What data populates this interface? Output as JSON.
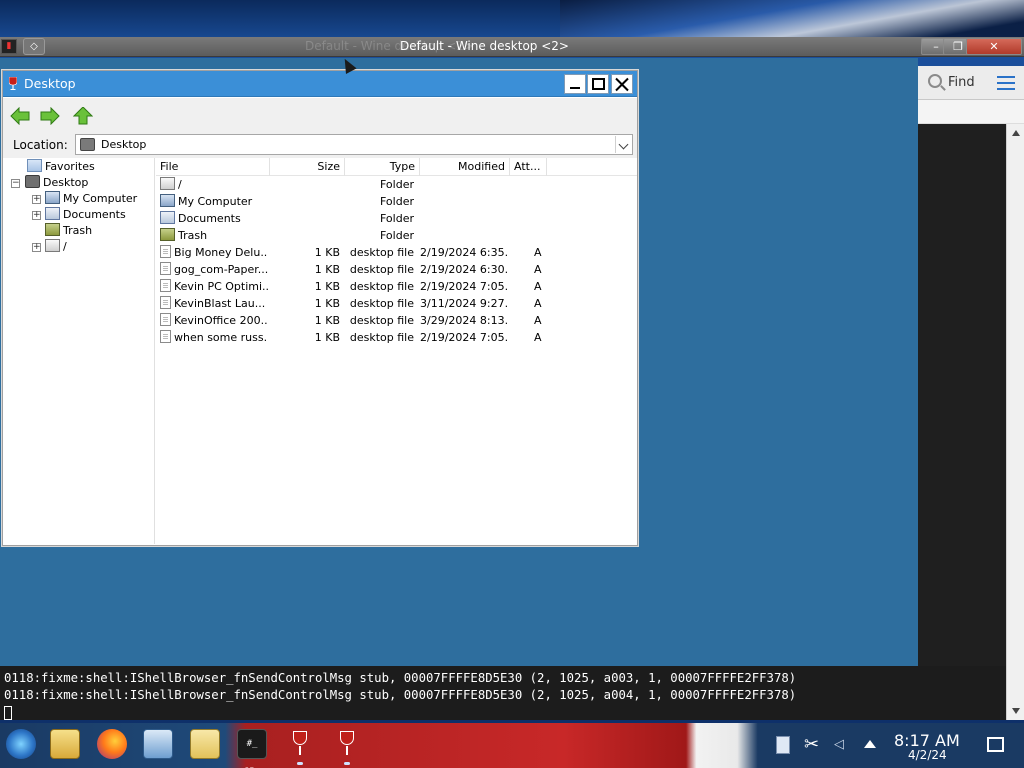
{
  "wine_desktop": {
    "title": "Default - Wine desktop <2>",
    "title_ghost": "Default - Wine desktop <2>",
    "minimize_icon": "minimize-icon",
    "restore_icon": "restore-icon",
    "close_icon": "close-icon"
  },
  "side_panel": {
    "find_label": "Find",
    "menu_icon": "hamburger-icon"
  },
  "explorer": {
    "title": "Desktop",
    "location_label": "Location:",
    "location_value": "Desktop",
    "tree": [
      {
        "label": "Favorites",
        "icon": "favorites-icon"
      },
      {
        "label": "Desktop",
        "icon": "desktop-icon",
        "expander": "−"
      },
      {
        "label": "My Computer",
        "icon": "computer-icon",
        "expander": "+"
      },
      {
        "label": "Documents",
        "icon": "documents-icon",
        "expander": "+"
      },
      {
        "label": "Trash",
        "icon": "trash-icon"
      },
      {
        "label": "/",
        "icon": "drive-icon",
        "expander": "+"
      }
    ],
    "columns": {
      "file": "File",
      "size": "Size",
      "type": "Type",
      "modified": "Modified",
      "attributes": "Att..."
    },
    "rows": [
      {
        "name": "/",
        "size": "",
        "type": "Folder",
        "modified": "",
        "attr": "",
        "icon": "drive"
      },
      {
        "name": "My Computer",
        "size": "",
        "type": "Folder",
        "modified": "",
        "attr": "",
        "icon": "comp"
      },
      {
        "name": "Documents",
        "size": "",
        "type": "Folder",
        "modified": "",
        "attr": "",
        "icon": "docs"
      },
      {
        "name": "Trash",
        "size": "",
        "type": "Folder",
        "modified": "",
        "attr": "",
        "icon": "trash"
      },
      {
        "name": "Big Money Delu...",
        "size": "1 KB",
        "type": "desktop file",
        "modified": "2/19/2024 6:35...",
        "attr": "A",
        "icon": "file"
      },
      {
        "name": "gog_com-Paper...",
        "size": "1 KB",
        "type": "desktop file",
        "modified": "2/19/2024 6:30...",
        "attr": "A",
        "icon": "file"
      },
      {
        "name": "Kevin PC Optimi...",
        "size": "1 KB",
        "type": "desktop file",
        "modified": "2/19/2024 7:05...",
        "attr": "A",
        "icon": "file"
      },
      {
        "name": "KevinBlast Lau...",
        "size": "1 KB",
        "type": "desktop file",
        "modified": "3/11/2024 9:27...",
        "attr": "A",
        "icon": "file"
      },
      {
        "name": "KevinOffice 200...",
        "size": "1 KB",
        "type": "desktop file",
        "modified": "3/29/2024 8:13...",
        "attr": "A",
        "icon": "file"
      },
      {
        "name": "when some russ...",
        "size": "1 KB",
        "type": "desktop file",
        "modified": "2/19/2024 7:05...",
        "attr": "A",
        "icon": "file"
      }
    ]
  },
  "terminal": {
    "lines": [
      "0118:fixme:shell:IShellBrowser_fnSendControlMsg stub, 00007FFFFE8D5E30 (2, 1025, a003, 1, 00007FFFFE2FF378)",
      "0118:fixme:shell:IShellBrowser_fnSendControlMsg stub, 00007FFFFE8D5E30 (2, 1025, a004, 1, 00007FFFFE2FF378)"
    ]
  },
  "taskbar": {
    "terminal_glyph": "#_ J5_",
    "clock_time": "8:17 AM",
    "clock_date": "4/2/24",
    "icons": [
      "start-icon",
      "file-manager-icon",
      "firefox-icon",
      "settings-icon",
      "notes-icon",
      "terminal-icon",
      "wine-icon",
      "wine-icon"
    ]
  },
  "colors": {
    "wine_bg": "#2e6e9e",
    "explorer_title": "#3b8fd7",
    "taskbar_red": "#c82828"
  }
}
